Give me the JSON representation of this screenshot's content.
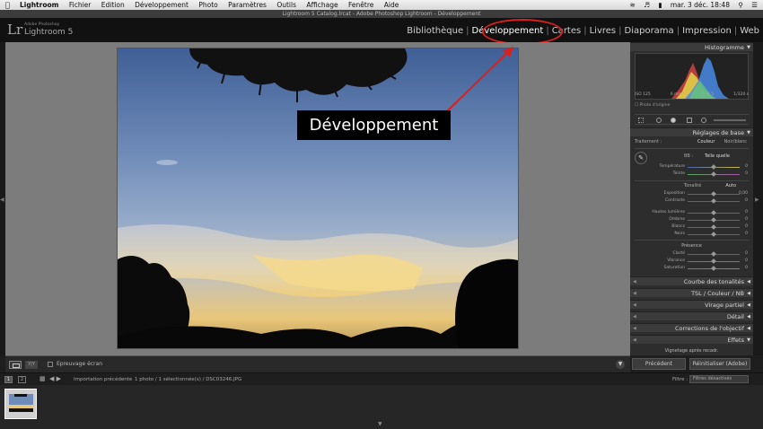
{
  "menubar": {
    "apple_icon": "apple-icon",
    "items": [
      "Lightroom",
      "Fichier",
      "Edition",
      "Développement",
      "Photo",
      "Paramètres",
      "Outils",
      "Affichage",
      "Fenêtre",
      "Aide"
    ],
    "clock": "mar. 3 déc.  18:48"
  },
  "window_title": "Lightroom 5 Catalog.lrcat - Adobe Photoshop Lightroom - Développement",
  "identity": {
    "logo": "Lr",
    "sub": "Adobe Photoshop",
    "name": "Lightroom 5"
  },
  "modules": [
    {
      "label": "Bibliothèque",
      "active": false
    },
    {
      "label": "Développement",
      "active": true
    },
    {
      "label": "Cartes",
      "active": false
    },
    {
      "label": "Livres",
      "active": false
    },
    {
      "label": "Diaporama",
      "active": false
    },
    {
      "label": "Impression",
      "active": false
    },
    {
      "label": "Web",
      "active": false
    }
  ],
  "callout": "Développement",
  "colors": {
    "annotation": "#d8201f"
  },
  "right_panel": {
    "histogram_title": "Histogramme",
    "histo_info": [
      "ISO 125",
      "6 mm",
      "f / 6,5",
      "1/320 s"
    ],
    "photo_original": "Photo d'origine",
    "basic_title": "Réglages de base",
    "treatment_label": "Traitement :",
    "treatment_color": "Couleur",
    "treatment_bw": "Noir/blanc",
    "wb_label": "BB :",
    "wb_value": "Telle quelle",
    "tonality_label": "Tonalité",
    "auto_label": "Auto",
    "presence_label": "Présence",
    "sliders": [
      {
        "label": "Température",
        "value": "0"
      },
      {
        "label": "Teinte",
        "value": "0"
      },
      {
        "label": "Exposition",
        "value": "0,00"
      },
      {
        "label": "Contraste",
        "value": "0"
      },
      {
        "label": "Hautes lumières",
        "value": "0"
      },
      {
        "label": "Ombres",
        "value": "0"
      },
      {
        "label": "Blancs",
        "value": "0"
      },
      {
        "label": "Noirs",
        "value": "0"
      },
      {
        "label": "Clarté",
        "value": "0"
      },
      {
        "label": "Vibrance",
        "value": "0"
      },
      {
        "label": "Saturation",
        "value": "0"
      }
    ],
    "panels": [
      "Courbe des tonalités",
      "TSL  /  Couleur  /  NB",
      "Virage partiel",
      "Détail",
      "Corrections de l'objectif",
      "Effets"
    ],
    "vignette_label": "Vignetage après recadr.",
    "previous_button": "Précédent",
    "reset_button": "Réinitialiser (Adobe)"
  },
  "toolbar": {
    "yy_label": "Y|Y",
    "softproof_label": "Epreuvage écran"
  },
  "filmbar": {
    "screen1": "1",
    "screen2": "2",
    "source": "Importation précédente",
    "count": "1 photo / 1 sélectionnée(s) / DSC03246.JPG",
    "filter_label": "Filtre :",
    "filter_value": "Filtres désactivés"
  }
}
